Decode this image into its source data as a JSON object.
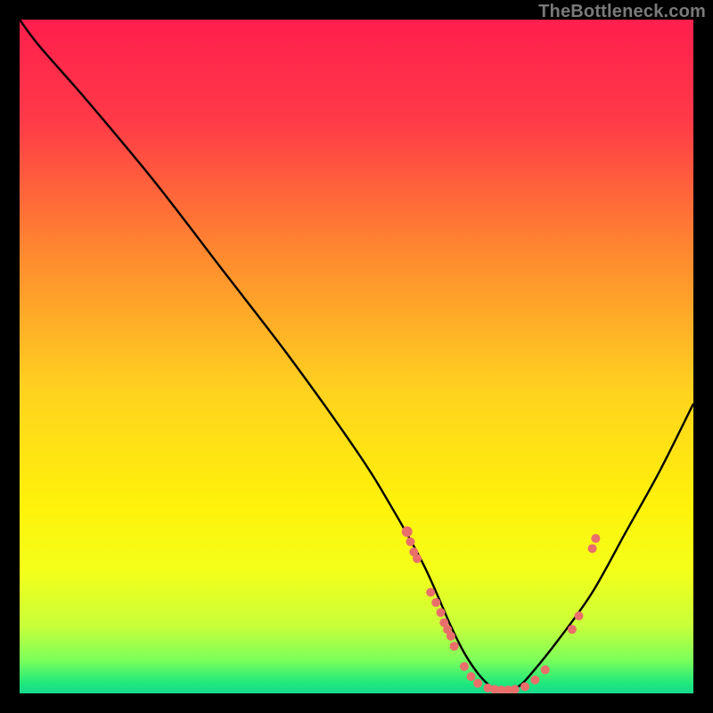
{
  "watermark": "TheBottleneck.com",
  "chart_data": {
    "type": "line",
    "title": "",
    "xlabel": "",
    "ylabel": "",
    "xlim": [
      0,
      100
    ],
    "ylim": [
      0,
      100
    ],
    "grid": false,
    "series": [
      {
        "name": "curve",
        "x": [
          0,
          3,
          10,
          20,
          30,
          40,
          50,
          55,
          60,
          64,
          66,
          68,
          70,
          72,
          74,
          76,
          80,
          85,
          90,
          95,
          100
        ],
        "y": [
          100,
          96,
          88,
          76,
          63,
          50,
          36,
          28,
          19,
          10,
          6,
          3,
          1,
          0.5,
          1,
          3,
          8,
          15,
          24,
          33,
          43
        ]
      }
    ],
    "markers": [
      {
        "x": 57.5,
        "y": 24.0,
        "r": 6
      },
      {
        "x": 58.0,
        "y": 22.5,
        "r": 5
      },
      {
        "x": 58.5,
        "y": 21.0,
        "r": 5
      },
      {
        "x": 59.0,
        "y": 20.0,
        "r": 5
      },
      {
        "x": 61.0,
        "y": 15.0,
        "r": 5
      },
      {
        "x": 61.8,
        "y": 13.5,
        "r": 5
      },
      {
        "x": 62.5,
        "y": 12.0,
        "r": 5
      },
      {
        "x": 63.0,
        "y": 10.5,
        "r": 5
      },
      {
        "x": 63.5,
        "y": 9.5,
        "r": 5
      },
      {
        "x": 64.0,
        "y": 8.5,
        "r": 5
      },
      {
        "x": 64.5,
        "y": 7.0,
        "r": 5
      },
      {
        "x": 66.0,
        "y": 4.0,
        "r": 5
      },
      {
        "x": 67.0,
        "y": 2.5,
        "r": 5
      },
      {
        "x": 68.0,
        "y": 1.5,
        "r": 5
      },
      {
        "x": 69.5,
        "y": 0.8,
        "r": 5
      },
      {
        "x": 70.5,
        "y": 0.6,
        "r": 5
      },
      {
        "x": 71.5,
        "y": 0.5,
        "r": 5
      },
      {
        "x": 72.5,
        "y": 0.5,
        "r": 5
      },
      {
        "x": 73.5,
        "y": 0.6,
        "r": 5
      },
      {
        "x": 75.0,
        "y": 1.0,
        "r": 5
      },
      {
        "x": 76.5,
        "y": 2.0,
        "r": 5
      },
      {
        "x": 78.0,
        "y": 3.5,
        "r": 5
      },
      {
        "x": 82.0,
        "y": 9.5,
        "r": 5
      },
      {
        "x": 83.0,
        "y": 11.5,
        "r": 5
      },
      {
        "x": 85.0,
        "y": 21.5,
        "r": 5
      },
      {
        "x": 85.5,
        "y": 23.0,
        "r": 5
      }
    ],
    "gradient_stops": [
      {
        "offset": 0.0,
        "color": "#ff1f4d"
      },
      {
        "offset": 0.15,
        "color": "#ff3a48"
      },
      {
        "offset": 0.35,
        "color": "#ff8a2f"
      },
      {
        "offset": 0.55,
        "color": "#ffd21f"
      },
      {
        "offset": 0.72,
        "color": "#fff20a"
      },
      {
        "offset": 0.82,
        "color": "#f3ff1a"
      },
      {
        "offset": 0.9,
        "color": "#c8ff3a"
      },
      {
        "offset": 0.95,
        "color": "#7dff5a"
      },
      {
        "offset": 0.985,
        "color": "#1fe87b"
      },
      {
        "offset": 1.0,
        "color": "#18d98e"
      }
    ],
    "marker_color": "#e96f6b",
    "curve_color": "#000000"
  }
}
